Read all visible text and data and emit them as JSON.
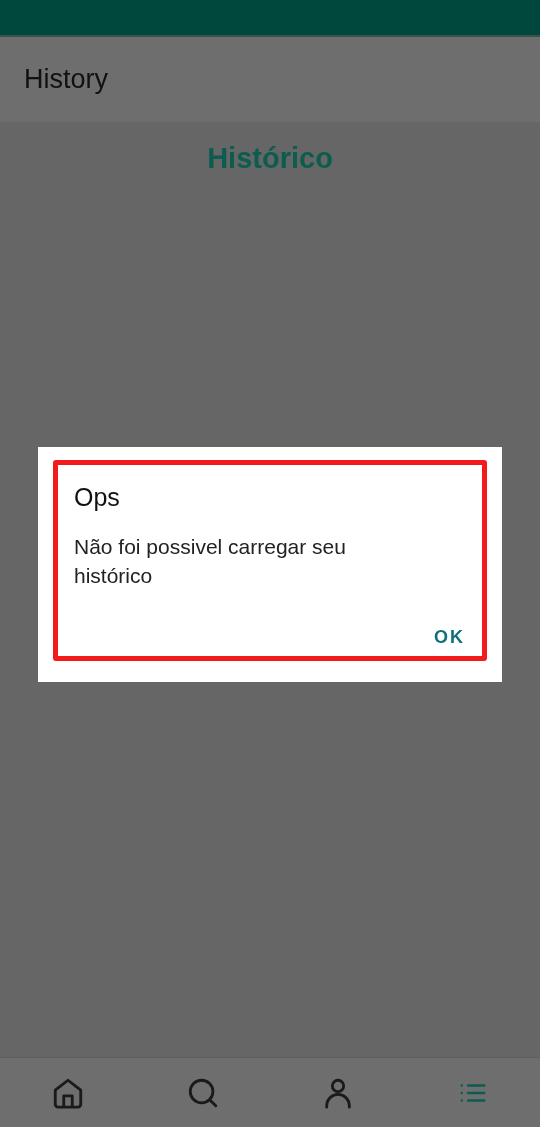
{
  "app_bar": {
    "title": "History"
  },
  "page": {
    "heading": "Histórico"
  },
  "dialog": {
    "title": "Ops",
    "message": "Não foi possivel carregar seu histórico",
    "highlighted": true,
    "buttons": [
      "OK"
    ]
  },
  "bottom_nav": [
    {
      "kind": "home",
      "selected": false
    },
    {
      "kind": "search",
      "selected": false
    },
    {
      "kind": "profile",
      "selected": false
    },
    {
      "kind": "list",
      "selected": true
    }
  ]
}
